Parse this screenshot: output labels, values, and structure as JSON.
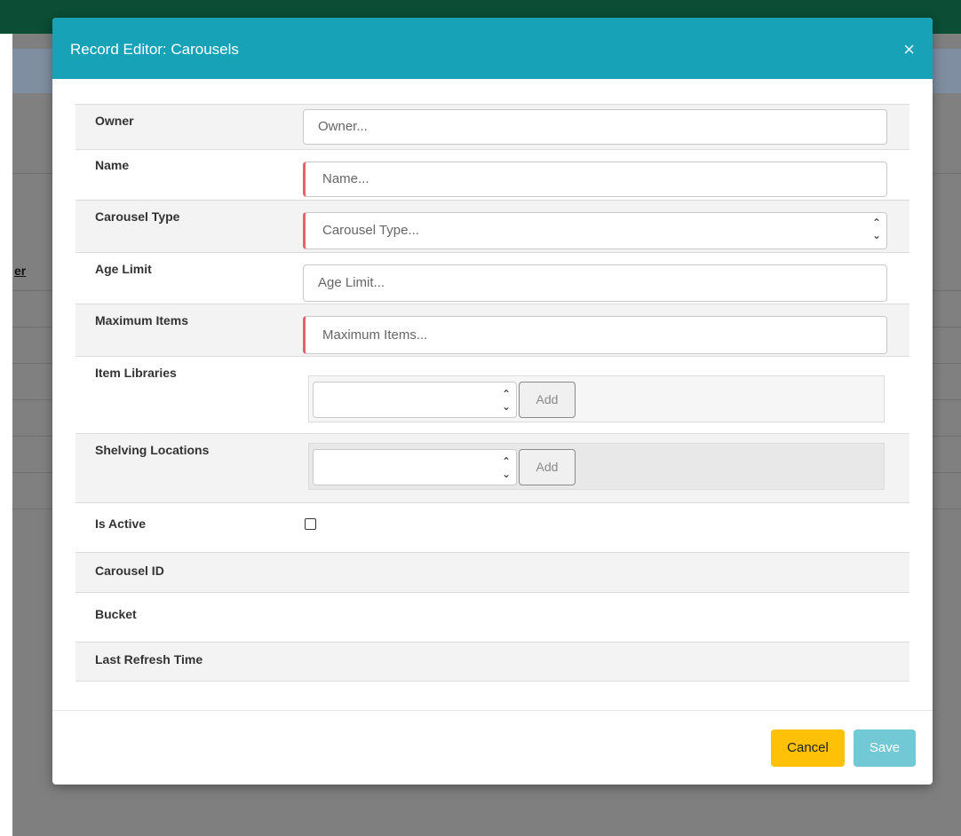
{
  "background": {
    "column_link": "er"
  },
  "modal": {
    "title": "Record Editor: Carousels",
    "close_glyph": "×",
    "fields": {
      "owner": {
        "label": "Owner",
        "placeholder": "Owner...",
        "required": false
      },
      "name": {
        "label": "Name",
        "placeholder": "Name...",
        "required": true
      },
      "carousel_type": {
        "label": "Carousel Type",
        "placeholder": "Carousel Type...",
        "required": true
      },
      "age_limit": {
        "label": "Age Limit",
        "placeholder": "Age Limit...",
        "required": false
      },
      "maximum_items": {
        "label": "Maximum Items",
        "placeholder": "Maximum Items...",
        "required": true
      },
      "item_libraries": {
        "label": "Item Libraries",
        "add_label": "Add"
      },
      "shelving_locations": {
        "label": "Shelving Locations",
        "add_label": "Add"
      },
      "is_active": {
        "label": "Is Active",
        "checked": false
      },
      "carousel_id": {
        "label": "Carousel ID",
        "value": ""
      },
      "bucket": {
        "label": "Bucket",
        "value": ""
      },
      "last_refresh_time": {
        "label": "Last Refresh Time",
        "value": ""
      }
    },
    "footer": {
      "cancel_label": "Cancel",
      "save_label": "Save"
    }
  },
  "colors": {
    "header": "#17a2b8",
    "required_marker": "#e8606a",
    "cancel": "#ffc107",
    "save": "#72c9d5"
  }
}
